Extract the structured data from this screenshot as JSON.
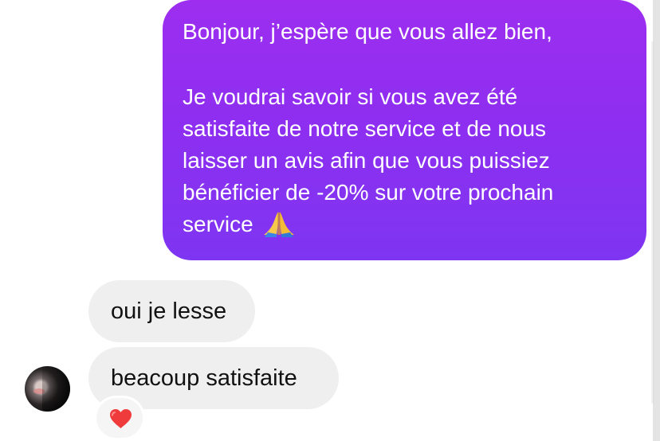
{
  "conversation": {
    "sent_message": {
      "lines": [
        "Bonjour, j’espère que vous allez bien,",
        "",
        "Je voudrai savoir si vous avez été",
        "satisfaite de notre service et de nous",
        "laisser un avis afin que vous puissiez",
        "bénéficier de -20% sur votre prochain",
        "service"
      ],
      "emoji_icon": "folded-hands-emoji-icon",
      "bubble_color": "#8f2ef0"
    },
    "received_messages": [
      {
        "text": "oui je lesse"
      },
      {
        "text": "beacoup satisfaite"
      }
    ],
    "reaction": {
      "icon": "red-heart-icon",
      "color": "#ef3b3b"
    },
    "avatar": {
      "icon": "contact-avatar"
    }
  }
}
